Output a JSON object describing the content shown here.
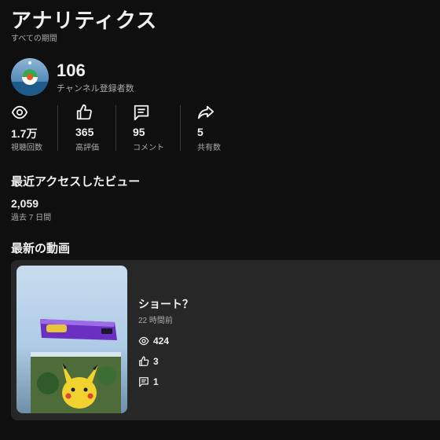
{
  "header": {
    "title": "アナリティクス",
    "subtitle": "すべての期間"
  },
  "channel": {
    "subscribers": "106",
    "subscribers_label": "チャンネル登録者数"
  },
  "stats": [
    {
      "icon": "eye-icon",
      "value": "1.7万",
      "label": "視聴回数"
    },
    {
      "icon": "thumbs-up-icon",
      "value": "365",
      "label": "高評価"
    },
    {
      "icon": "comment-icon",
      "value": "95",
      "label": "コメント"
    },
    {
      "icon": "share-icon",
      "value": "5",
      "label": "共有数"
    }
  ],
  "recent_views": {
    "heading": "最近アクセスしたビュー",
    "value": "2,059",
    "period": "過去 7 日間"
  },
  "latest_video": {
    "heading": "最新の動画",
    "title": "ショート？",
    "time": "22 時間前",
    "views": "424",
    "likes": "3",
    "comments": "1"
  },
  "colors": {
    "background": "#0f0f0f",
    "card": "#272727",
    "text": "#f1f1f1",
    "secondary": "#aaaaaa"
  }
}
